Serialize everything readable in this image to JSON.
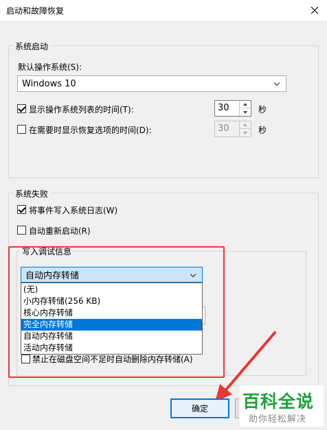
{
  "window": {
    "title": "启动和故障恢复"
  },
  "system_startup": {
    "legend": "系统启动",
    "default_os_label": "默认操作系统(S):",
    "default_os_value": "Windows 10",
    "show_os_list": {
      "label": "显示操作系统列表的时间(T):",
      "checked": true,
      "value": "30",
      "unit": "秒"
    },
    "show_recovery": {
      "label": "在需要时显示恢复选项的时间(D):",
      "checked": false,
      "value": "30",
      "unit": "秒"
    }
  },
  "system_failure": {
    "legend": "系统失败",
    "write_event_log": {
      "label": "将事件写入系统日志(W)",
      "checked": true
    },
    "auto_restart": {
      "label": "自动重新启动(R)",
      "checked": false
    },
    "debug_info": {
      "legend": "写入调试信息",
      "selected": "自动内存转储",
      "options": [
        "(无)",
        "小内存转储(256 KB)",
        "核心内存转储",
        "完全内存转储",
        "自动内存转储",
        "活动内存转储"
      ],
      "highlighted_index": 3
    },
    "disable_auto_delete": {
      "label": "禁止在磁盘空间不足时自动删除内存转储(A)",
      "checked": false
    }
  },
  "buttons": {
    "ok": "确定"
  },
  "watermark": {
    "title": "百科全说",
    "subtitle": "助你轻松解决"
  },
  "colors": {
    "accent": "#0078d7",
    "annotation_red": "#e53935",
    "watermark_green": "#1aa336"
  }
}
